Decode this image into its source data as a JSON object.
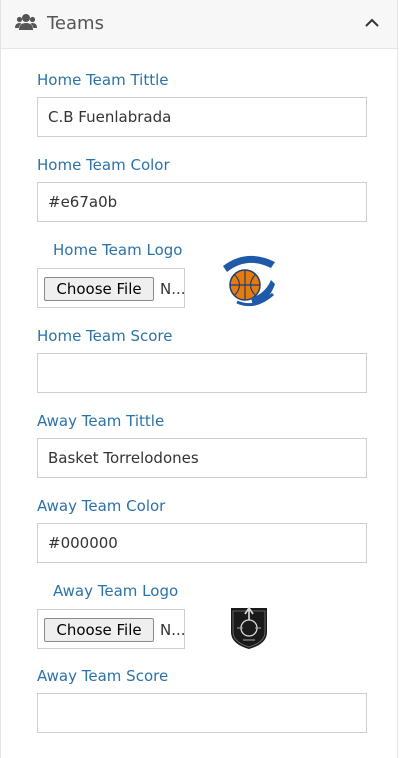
{
  "panel": {
    "title": "Teams",
    "header_icon": "users-icon",
    "collapse_icon": "chevron-up-icon"
  },
  "home": {
    "title_label": "Home Team Tittle",
    "title_value": "C.B Fuenlabrada",
    "color_label": "Home Team Color",
    "color_value": "#e67a0b",
    "logo_label": "Home Team Logo",
    "choose_file": "Choose File",
    "file_status": "N...",
    "score_label": "Home Team Score",
    "score_value": ""
  },
  "away": {
    "title_label": "Away Team Tittle",
    "title_value": "Basket Torrelodones",
    "color_label": "Away Team Color",
    "color_value": "#000000",
    "logo_label": "Away Team Logo",
    "choose_file": "Choose File",
    "file_status": "N...",
    "score_label": "Away Team Score",
    "score_value": ""
  }
}
